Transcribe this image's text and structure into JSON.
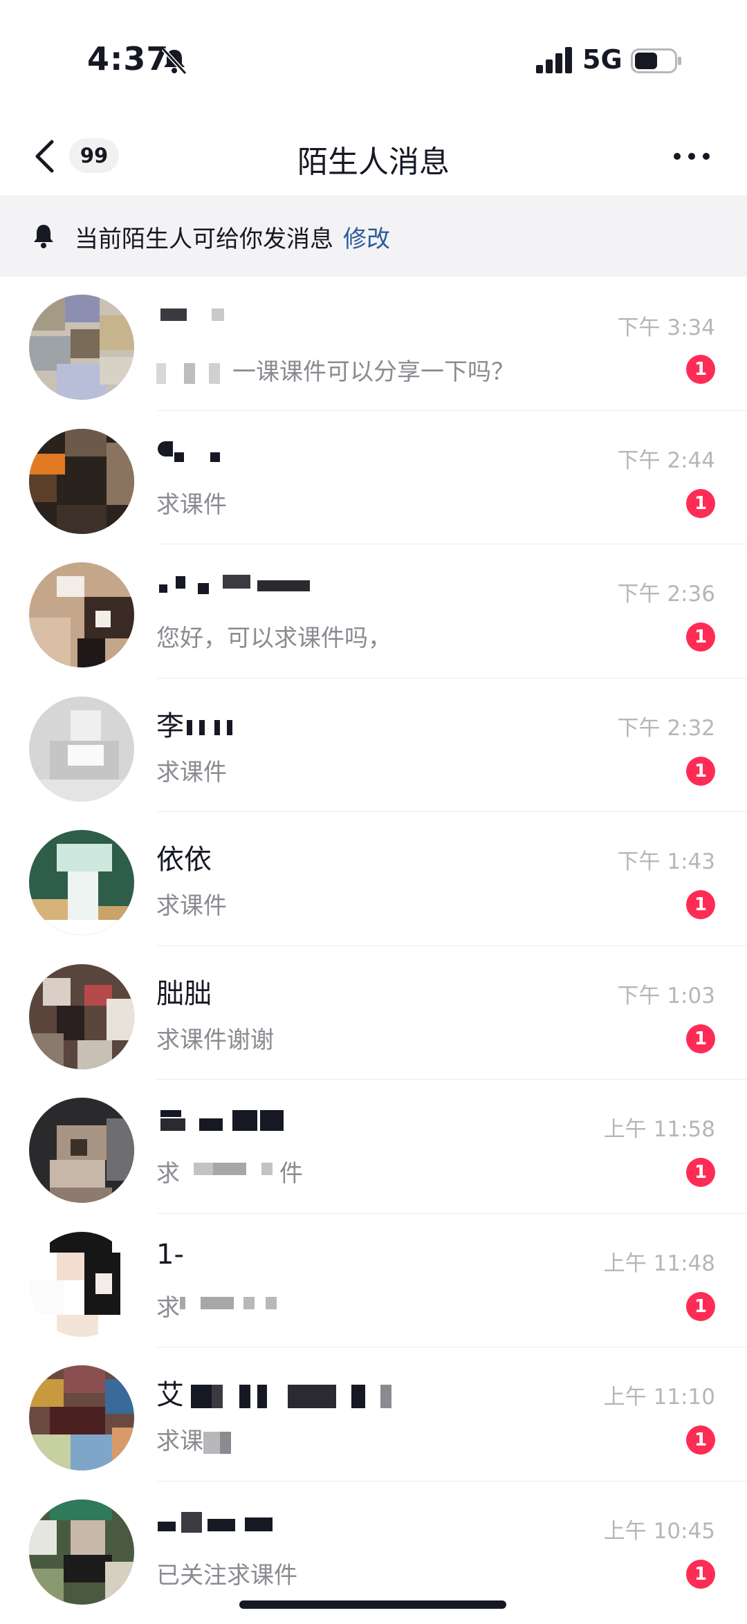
{
  "status_bar": {
    "time": "4:37",
    "network": "5G"
  },
  "header": {
    "unread_count": "99",
    "title": "陌生人消息"
  },
  "notice": {
    "text": "当前陌生人可给你发消息",
    "link": "修改"
  },
  "colors": {
    "accent_red": "#fe2c55",
    "link_blue": "#2b5c9d",
    "notice_bg": "#f3f3f5"
  },
  "messages": [
    {
      "name": "",
      "preview": "一课课件可以分享一下吗？",
      "time": "下午 3:34",
      "unread": "1"
    },
    {
      "name": "",
      "preview": "求课件",
      "time": "下午 2:44",
      "unread": "1"
    },
    {
      "name": "",
      "preview": "您好，可以求课件吗，",
      "time": "下午 2:36",
      "unread": "1"
    },
    {
      "name": "李",
      "preview": "求课件",
      "time": "下午 2:32",
      "unread": "1"
    },
    {
      "name": "依依",
      "preview": "求课件",
      "time": "下午 1:43",
      "unread": "1"
    },
    {
      "name": "朏朏",
      "preview": "求课件谢谢",
      "time": "下午 1:03",
      "unread": "1"
    },
    {
      "name": "",
      "preview": "求",
      "preview_tail": "件",
      "time": "上午 11:58",
      "unread": "1"
    },
    {
      "name": "1-",
      "preview": "求",
      "time": "上午 11:48",
      "unread": "1"
    },
    {
      "name": "艾",
      "preview": "求课",
      "time": "上午 11:10",
      "unread": "1"
    },
    {
      "name": "",
      "preview": "已关注求课件",
      "time": "上午 10:45",
      "unread": "1"
    }
  ]
}
